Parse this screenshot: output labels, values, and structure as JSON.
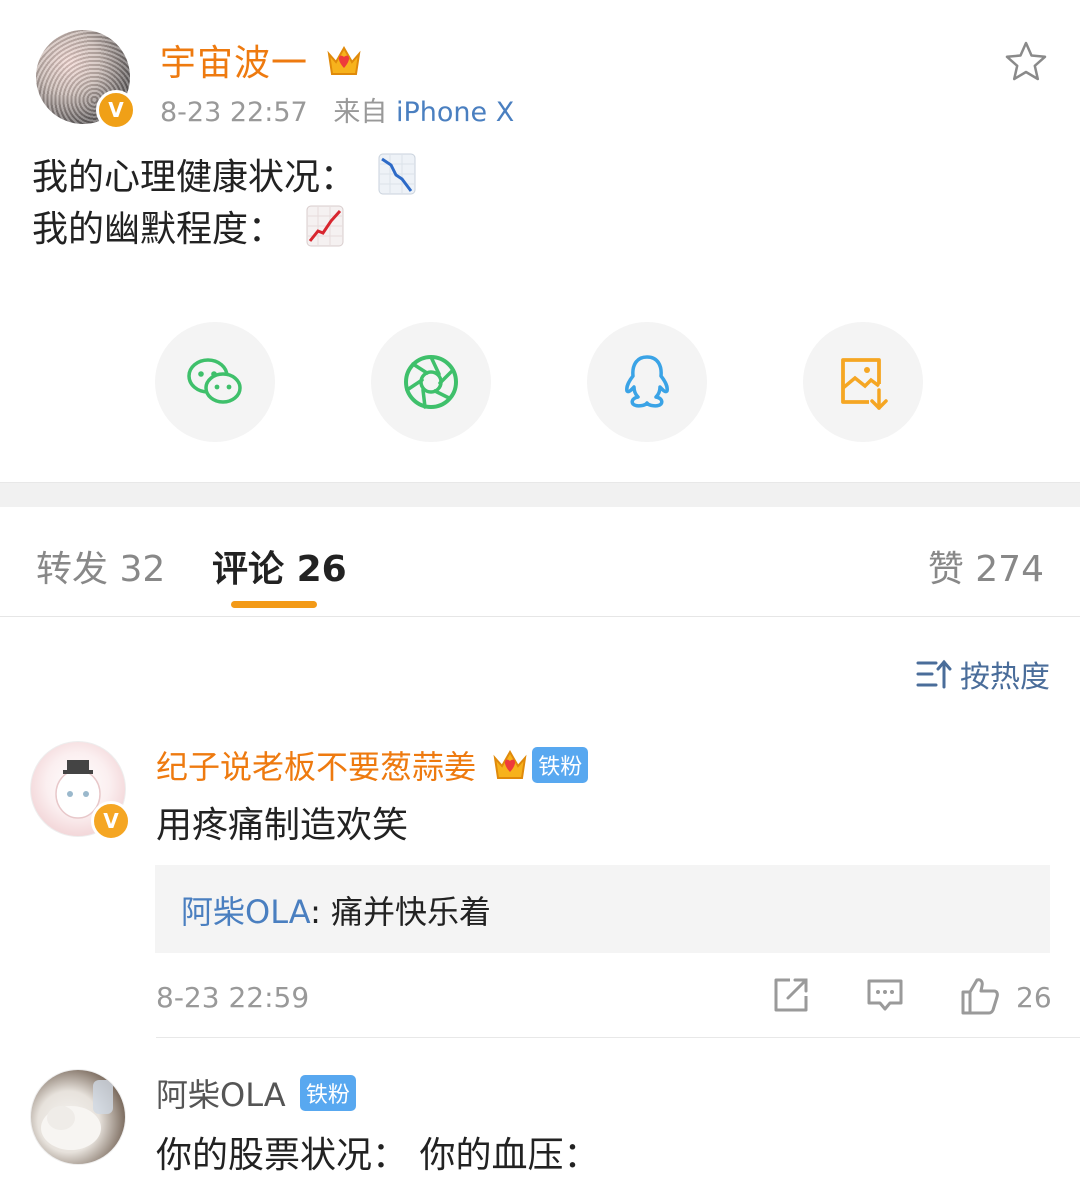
{
  "post": {
    "author": "宇宙波一",
    "time": "8-23 22:57",
    "source_prefix": "来自",
    "source": "iPhone X",
    "line1": "我的心理健康状况：",
    "line2": "我的幽默程度：",
    "verified_badge": "V"
  },
  "share": {
    "icons": [
      "wechat-icon",
      "moments-icon",
      "qq-icon",
      "save-image-icon"
    ]
  },
  "tabs": {
    "repost_label": "转发",
    "repost_count": "32",
    "comment_label": "评论",
    "comment_count": "26",
    "like_label": "赞",
    "like_count": "274"
  },
  "sort": {
    "label": "按热度"
  },
  "comments": [
    {
      "user": "纪子说老板不要葱蒜姜",
      "fan_badge": "铁粉",
      "text": "用疼痛制造欢笑",
      "reply_user": "阿柴OLA",
      "reply_sep": ":",
      "reply_text": " 痛并快乐着",
      "time": "8-23 22:59",
      "likes": "26",
      "verified_badge": "V"
    },
    {
      "user": "阿柴OLA",
      "fan_badge": "铁粉",
      "text": "你的股票状况：  你的血压："
    }
  ],
  "colors": {
    "accent": "#f39a17",
    "username_orange": "#ee7a0f",
    "link_blue": "#4a7fc0",
    "fan_badge_blue": "#58a8f0"
  }
}
